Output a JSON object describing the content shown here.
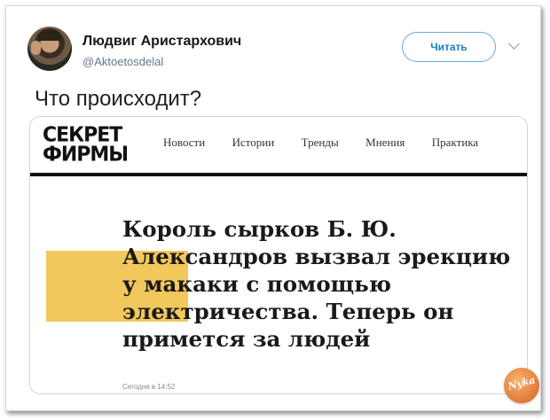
{
  "tweet": {
    "display_name": "Людвиг Аристархович",
    "handle": "@Aktoetosdelal",
    "follow_label": "Читать",
    "text": "Что происходит?"
  },
  "embedded_article": {
    "logo_lines": [
      "СЕКРЕТ",
      "ФИРМЫ"
    ],
    "nav": [
      "Новости",
      "Истории",
      "Тренды",
      "Мнения",
      "Практика"
    ],
    "headline_lines": [
      "Король сырков Б. Ю.",
      "Александров вызвал эрекцию",
      "у макаки с помощью",
      "электричества. Теперь он",
      "примется за людей"
    ],
    "date": "Сегодня в 14:52",
    "highlight_color": "#f2c75c"
  },
  "watermark": {
    "text": "Nyka"
  }
}
